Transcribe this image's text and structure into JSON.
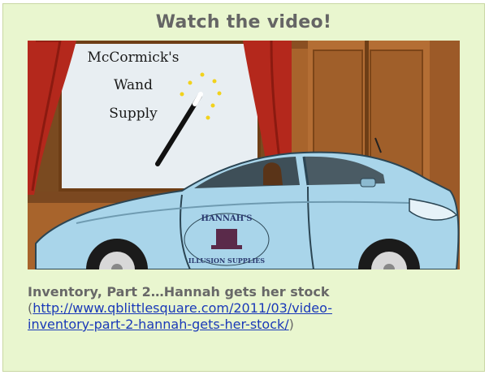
{
  "panel": {
    "title": "Watch the video!",
    "video": {
      "sign_lines": [
        "McCormick's",
        "Wand",
        "Supply"
      ],
      "car_decal_top": "HANNAH'S",
      "car_decal_bottom": "ILLUSION SUPPLIES"
    },
    "caption": {
      "title": "Inventory, Part 2…Hannah gets her stock",
      "paren_open": "(",
      "link_text_line1": "http://www.qblittlesquare.com/2011/03/video-",
      "link_text_line2": "inventory-part-2-hannah-gets-her-stock/",
      "paren_close": ")"
    }
  },
  "colors": {
    "panel_bg": "#e9f6cf",
    "title_text": "#656565",
    "link": "#1a39b8",
    "car_body": "#a9d5ea",
    "wall": "#a8642c",
    "curtain": "#b4281c"
  }
}
